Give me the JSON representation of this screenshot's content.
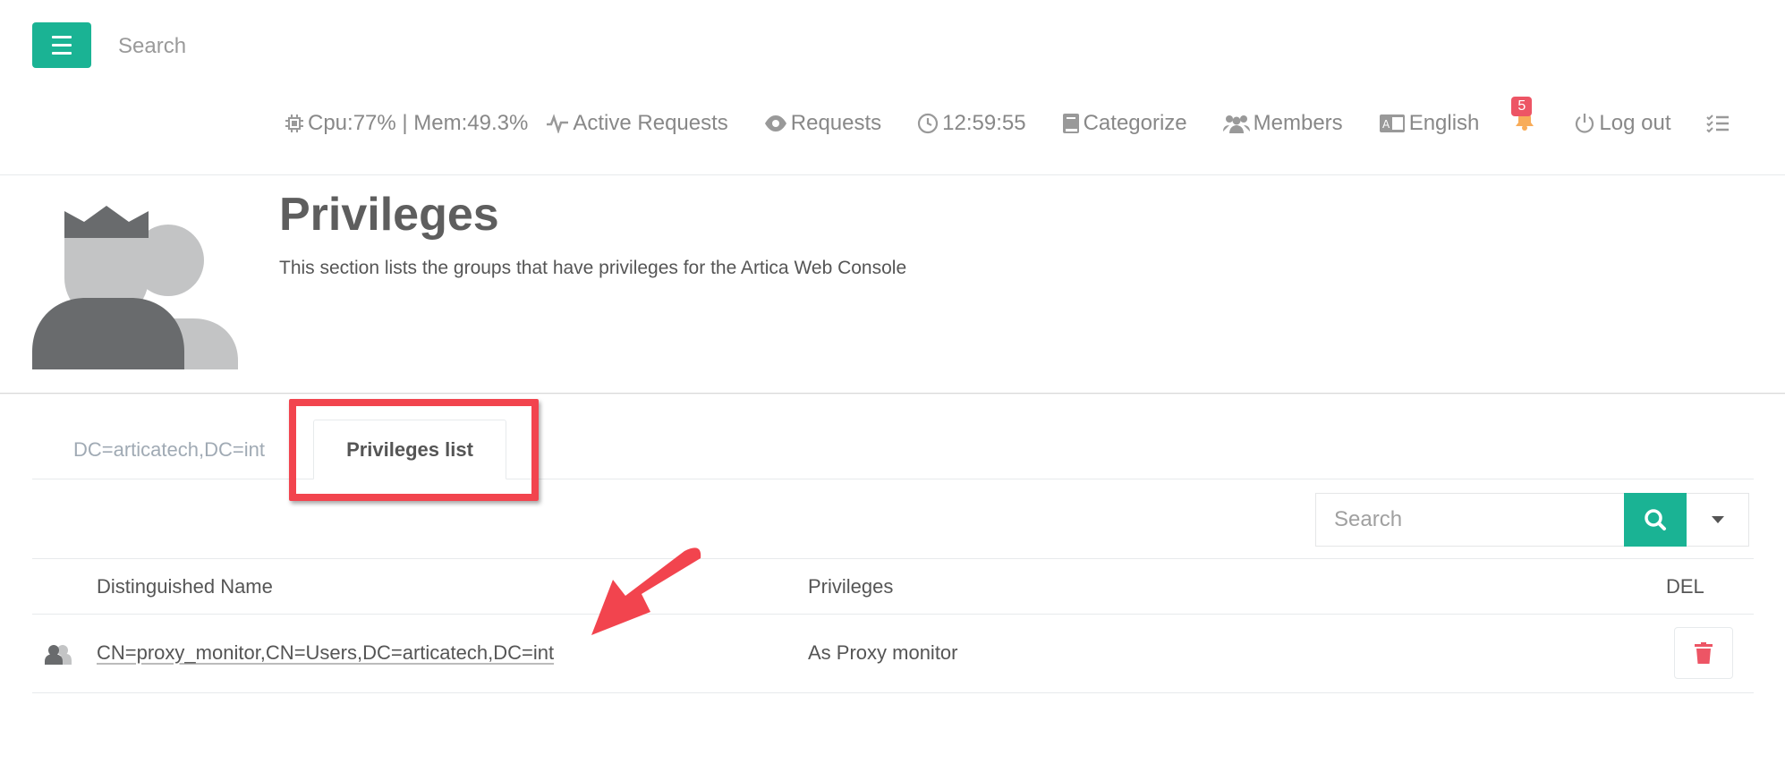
{
  "topbar": {
    "search_placeholder": "Search",
    "cpu_text": "Cpu:77% | Mem:49.3%",
    "active_requests": "Active Requests",
    "requests": "Requests",
    "clock": "12:59:55",
    "categorize": "Categorize",
    "members": "Members",
    "language": "English",
    "notification_count": "5",
    "logout": "Log out"
  },
  "header": {
    "title": "Privileges",
    "description": "This section lists the groups that have privileges for the Artica Web Console"
  },
  "tabs": [
    {
      "label": "DC=articatech,DC=int"
    },
    {
      "label": "Privileges list"
    }
  ],
  "table": {
    "search_placeholder": "Search",
    "columns": [
      "Distinguished Name",
      "Privileges",
      "DEL"
    ],
    "rows": [
      {
        "dn": "CN=proxy_monitor,CN=Users,DC=articatech,DC=int",
        "privileges": "As Proxy monitor"
      }
    ]
  },
  "colors": {
    "accent": "#1ab394",
    "danger": "#ed5565",
    "highlight": "#f2444e"
  }
}
